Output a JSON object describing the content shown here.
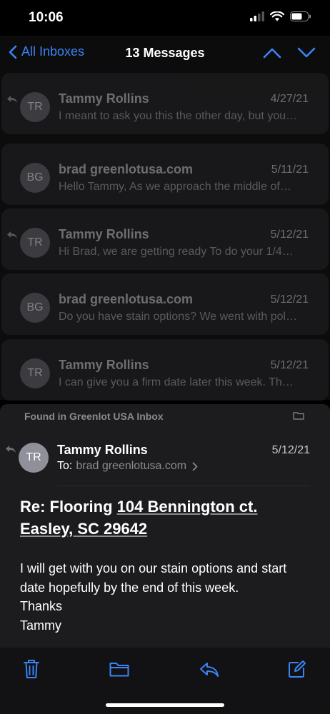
{
  "status_bar": {
    "time": "10:06"
  },
  "nav": {
    "back_label": "All Inboxes",
    "title": "13 Messages"
  },
  "messages": [
    {
      "initials": "TR",
      "sender": "Tammy Rollins",
      "date": "4/27/21",
      "preview": "I meant to ask you this the other day, but you…",
      "replied": true
    },
    {
      "initials": "BG",
      "sender": "brad greenlotusa.com",
      "date": "5/11/21",
      "preview": "Hello Tammy, As we approach the middle of…",
      "replied": false
    },
    {
      "initials": "TR",
      "sender": "Tammy Rollins",
      "date": "5/12/21",
      "preview": "Hi Brad, we are getting ready To do your 1/4…",
      "replied": true
    },
    {
      "initials": "BG",
      "sender": "brad greenlotusa.com",
      "date": "5/12/21",
      "preview": "Do you have stain options? We went with pol…",
      "replied": false
    },
    {
      "initials": "TR",
      "sender": "Tammy Rollins",
      "date": "5/12/21",
      "preview": "I can give you a firm date later this week. Th…",
      "replied": false
    }
  ],
  "found_in": "Found in Greenlot USA Inbox",
  "detail": {
    "initials": "TR",
    "sender": "Tammy Rollins",
    "date": "5/12/21",
    "to_label": "To:",
    "to": "brad greenlotusa.com",
    "subject_prefix": "Re: Flooring ",
    "subject_address_1": "104 Bennington ct.",
    "subject_address_2": "Easley, SC 29642",
    "body": [
      "I will get with you on our stain options and start",
      "date hopefully by the end of this week.",
      "Thanks",
      "Tammy"
    ]
  },
  "toolbar": {
    "icons": [
      "trash-icon",
      "folder-icon",
      "reply-icon",
      "compose-icon"
    ]
  },
  "colors": {
    "accent": "#3a84f6",
    "background": "#000000",
    "card": "#1c1c1e"
  }
}
